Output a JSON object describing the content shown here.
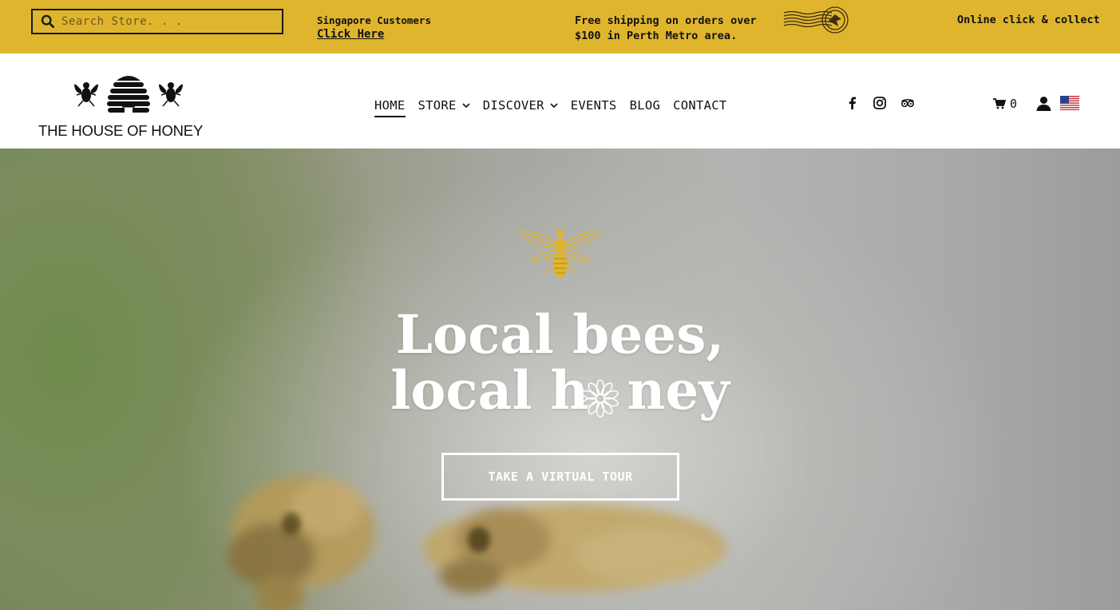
{
  "topbar": {
    "search": {
      "placeholder": "Search Store. . ."
    },
    "singapore": {
      "title": "Singapore Customers",
      "link": "Click Here"
    },
    "shipping_line1": "Free shipping on orders over",
    "shipping_line2": "$100 in Perth Metro area.",
    "collect": "Online click & collect",
    "background_color": "#e0b52e"
  },
  "header": {
    "logo_text": "THE HOUSE OF HONEY",
    "nav": [
      {
        "label": "HOME",
        "active": true,
        "dropdown": false
      },
      {
        "label": "STORE",
        "active": false,
        "dropdown": true
      },
      {
        "label": "DISCOVER",
        "active": false,
        "dropdown": true
      },
      {
        "label": "EVENTS",
        "active": false,
        "dropdown": false
      },
      {
        "label": "BLOG",
        "active": false,
        "dropdown": false
      },
      {
        "label": "CONTACT",
        "active": false,
        "dropdown": false
      }
    ],
    "social_icons": [
      "facebook-icon",
      "instagram-icon",
      "tripadvisor-icon"
    ],
    "cart_count": "0",
    "locale_flag": "us-flag-icon"
  },
  "hero": {
    "title_line1": "Local bees,",
    "title_line2_a": "local h",
    "title_line2_b": "ney",
    "cta_label": "TAKE A VIRTUAL TOUR",
    "accent_color": "#e0b52e"
  }
}
